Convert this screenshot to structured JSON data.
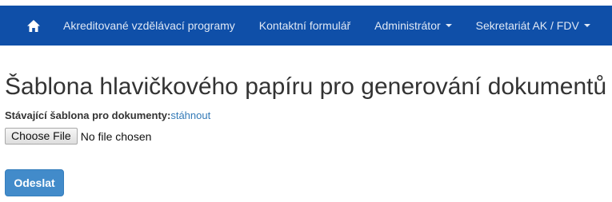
{
  "navbar": {
    "home_icon": "home-icon",
    "items": [
      {
        "label": "Akreditované vzdělávací programy",
        "dropdown": false
      },
      {
        "label": "Kontaktní formulář",
        "dropdown": false
      },
      {
        "label": "Administrátor",
        "dropdown": true
      },
      {
        "label": "Sekretariát AK / FDV",
        "dropdown": true
      }
    ],
    "background_color": "#0f4fa8"
  },
  "page": {
    "title": "Šablona hlavičkového papíru pro generování dokumentů",
    "current_template_label": "Stávající šablona pro dokumenty:",
    "current_template_link": "stáhnout",
    "file_input": {
      "button_label": "Choose File",
      "status": "No file chosen"
    },
    "submit_label": "Odeslat"
  },
  "colors": {
    "link": "#337ab7",
    "primary_button": "#428bca"
  }
}
